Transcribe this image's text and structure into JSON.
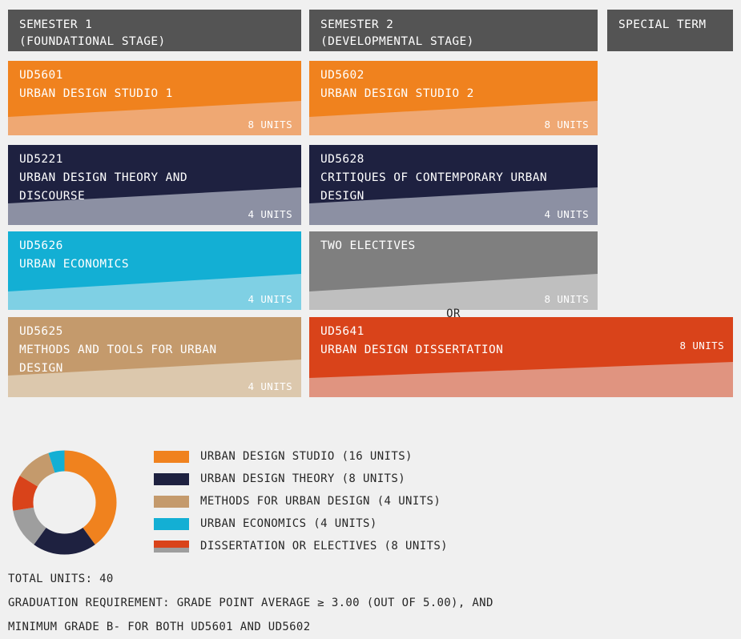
{
  "columns": [
    {
      "id": "semester-1",
      "title": "SEMESTER 1\n(FOUNDATIONAL STAGE)"
    },
    {
      "id": "semester-2",
      "title": "SEMESTER 2\n(DEVELOPMENTAL STAGE)"
    },
    {
      "id": "special-term",
      "title": "SPECIAL TERM"
    }
  ],
  "cards": [
    {
      "id": "ud5601",
      "code": "UD5601",
      "name": "URBAN DESIGN STUDIO 1",
      "text": "UD5601\nURBAN DESIGN STUDIO 1",
      "units": "8 UNITS",
      "color": "#f0821e",
      "accent": "#efa873"
    },
    {
      "id": "ud5602",
      "code": "UD5602",
      "name": "URBAN DESIGN STUDIO 2",
      "text": "UD5602\nURBAN DESIGN STUDIO 2",
      "units": "8 UNITS",
      "color": "#f0821e",
      "accent": "#efa873"
    },
    {
      "id": "ud5221",
      "code": "UD5221",
      "name": "URBAN DESIGN THEORY AND DISCOURSE",
      "text": "UD5221\nURBAN DESIGN THEORY AND\nDISCOURSE",
      "units": "4 UNITS",
      "color": "#1e2140",
      "accent": "#8c90a3"
    },
    {
      "id": "ud5628",
      "code": "UD5628",
      "name": "CRITIQUES OF CONTEMPORARY URBAN DESIGN",
      "text": "UD5628\nCRITIQUES OF CONTEMPORARY URBAN\nDESIGN",
      "units": "4 UNITS",
      "color": "#1e2140",
      "accent": "#8c90a3"
    },
    {
      "id": "ud5626",
      "code": "UD5626",
      "name": "URBAN ECONOMICS",
      "text": "UD5626\nURBAN ECONOMICS",
      "units": "4 UNITS",
      "color": "#13afd4",
      "accent": "#7fd0e4"
    },
    {
      "id": "two-electives",
      "code": "",
      "name": "TWO ELECTIVES",
      "text": "TWO ELECTIVES",
      "units": "8 UNITS",
      "color": "#7f7f7f",
      "accent": "#bfbfbf"
    },
    {
      "id": "ud5625",
      "code": "UD5625",
      "name": "METHODS AND TOOLS FOR URBAN DESIGN",
      "text": "UD5625\nMETHODS AND TOOLS FOR URBAN\nDESIGN",
      "units": "4 UNITS",
      "color": "#c49a6c",
      "accent": "#dcc8ad"
    },
    {
      "id": "ud5641",
      "code": "UD5641",
      "name": "URBAN DESIGN DISSERTATION",
      "text": "UD5641\nURBAN DESIGN DISSERTATION",
      "units": "8 UNITS",
      "color": "#d9431a",
      "accent": "#e09480"
    }
  ],
  "or_label": "OR",
  "chart_data": {
    "type": "pie",
    "title": "",
    "legend_position": "right",
    "total_units": 40,
    "categories": [
      "URBAN DESIGN STUDIO",
      "URBAN DESIGN THEORY",
      "DISSERTATION OR ELECTIVES",
      "DISSERTATION OR ELECTIVES",
      "METHODS FOR URBAN DESIGN",
      "URBAN ECONOMICS"
    ],
    "values": [
      16,
      8,
      4,
      4,
      4,
      4
    ],
    "colors": [
      "#f0821e",
      "#1e2140",
      "#9e9e9e",
      "#d9431a",
      "#c49a6c",
      "#13afd4"
    ],
    "legend": [
      {
        "label": "URBAN DESIGN STUDIO (16 UNITS)",
        "color": "#f0821e",
        "color2": ""
      },
      {
        "label": "URBAN DESIGN THEORY (8 UNITS)",
        "color": "#1e2140",
        "color2": ""
      },
      {
        "label": "METHODS FOR URBAN DESIGN (4 UNITS)",
        "color": "#c49a6c",
        "color2": ""
      },
      {
        "label": "URBAN ECONOMICS (4 UNITS)",
        "color": "#13afd4",
        "color2": ""
      },
      {
        "label": "DISSERTATION OR ELECTIVES (8 UNITS)",
        "color": "#d9431a",
        "color2": "#9e9e9e"
      }
    ]
  },
  "footer": {
    "total_units": "TOTAL UNITS: 40",
    "requirement_line1": "GRADUATION REQUIREMENT: GRADE POINT AVERAGE ≥ 3.00 (OUT OF 5.00), AND",
    "requirement_line2": "MINIMUM GRADE B- FOR BOTH UD5601 AND UD5602"
  }
}
